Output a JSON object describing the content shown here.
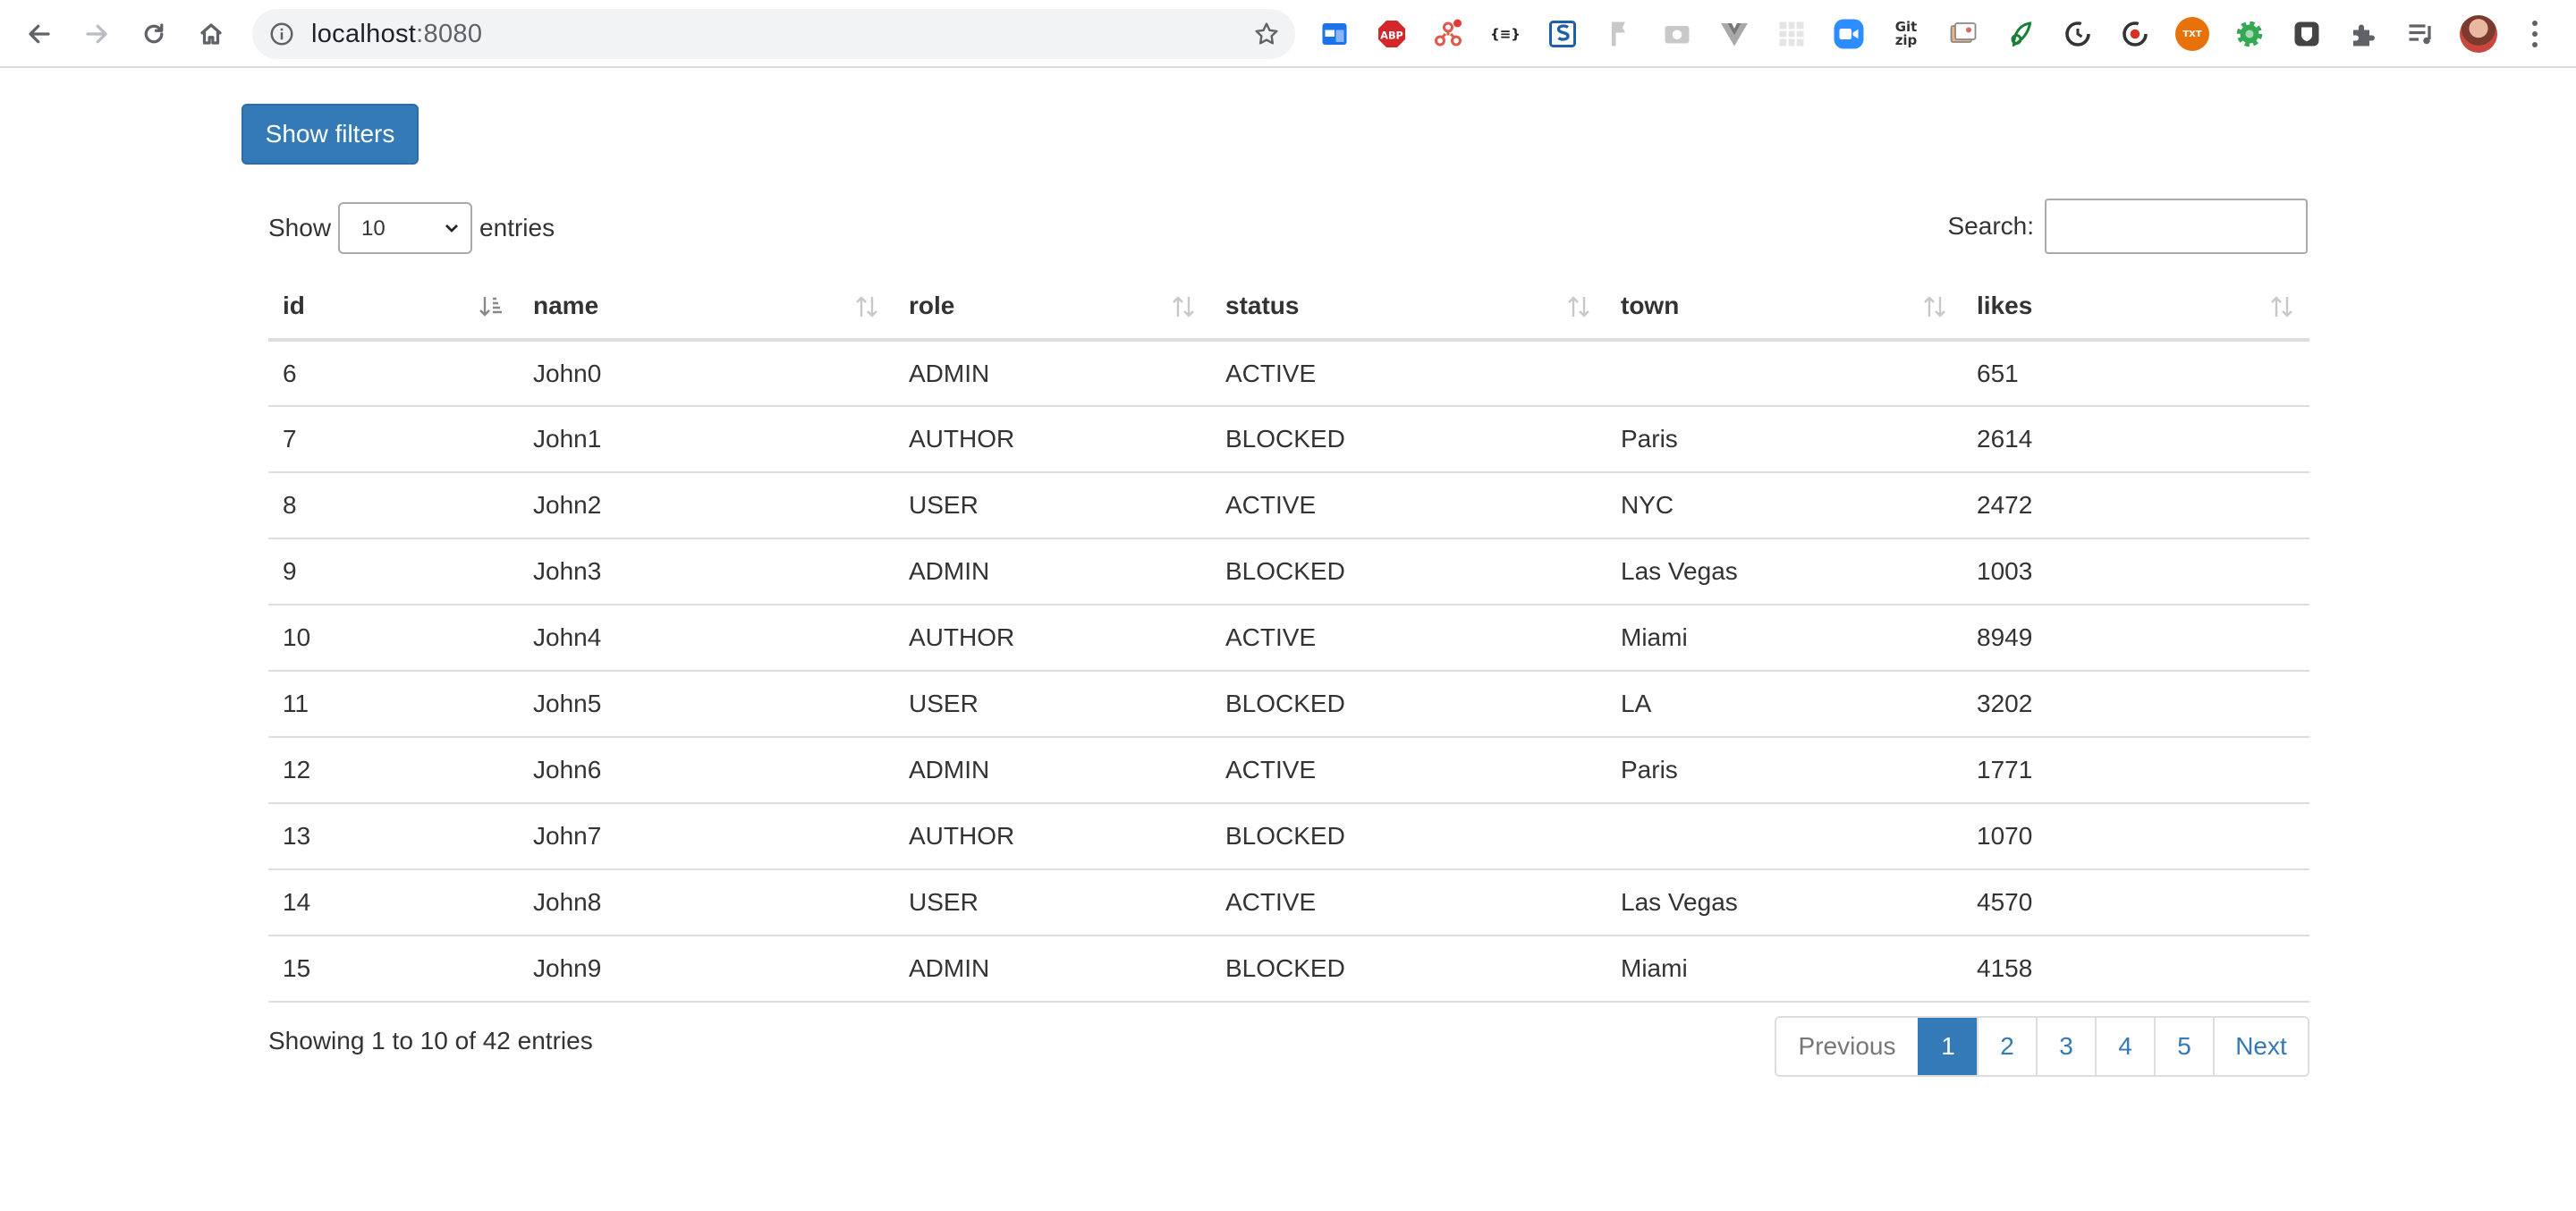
{
  "browser": {
    "url_host": "localhost",
    "url_port": ":8080",
    "extensions": [
      "calendar-extension-icon",
      "adblock-plus-icon",
      "network-extension-icon",
      "json-formatter-icon",
      "s-extension-icon",
      "bookmark-extension-icon",
      "camera-extension-icon",
      "vue-devtools-icon",
      "grid-extension-icon",
      "zoom-extension-icon",
      "gitzip-extension-icon",
      "screenshot-extension-icon",
      "leaf-extension-icon",
      "refresh-extension-icon",
      "record-extension-icon",
      "txt-extension-icon",
      "gear-extension-icon",
      "shield-extension-icon",
      "puzzle-extensions-icon",
      "reading-list-icon"
    ],
    "ext_labels": {
      "abp": "ABP",
      "json": "{≡}",
      "gitzip_top": "Git",
      "gitzip_bottom": "zip",
      "txt": "TXT"
    }
  },
  "page": {
    "filters_button": "Show filters",
    "length": {
      "before": "Show",
      "value": "10",
      "after": "entries"
    },
    "search": {
      "label": "Search:",
      "value": ""
    },
    "columns": [
      "id",
      "name",
      "role",
      "status",
      "town",
      "likes"
    ],
    "rows": [
      [
        "6",
        "John0",
        "ADMIN",
        "ACTIVE",
        "",
        "651"
      ],
      [
        "7",
        "John1",
        "AUTHOR",
        "BLOCKED",
        "Paris",
        "2614"
      ],
      [
        "8",
        "John2",
        "USER",
        "ACTIVE",
        "NYC",
        "2472"
      ],
      [
        "9",
        "John3",
        "ADMIN",
        "BLOCKED",
        "Las Vegas",
        "1003"
      ],
      [
        "10",
        "John4",
        "AUTHOR",
        "ACTIVE",
        "Miami",
        "8949"
      ],
      [
        "11",
        "John5",
        "USER",
        "BLOCKED",
        "LA",
        "3202"
      ],
      [
        "12",
        "John6",
        "ADMIN",
        "ACTIVE",
        "Paris",
        "1771"
      ],
      [
        "13",
        "John7",
        "AUTHOR",
        "BLOCKED",
        "",
        "1070"
      ],
      [
        "14",
        "John8",
        "USER",
        "ACTIVE",
        "Las Vegas",
        "4570"
      ],
      [
        "15",
        "John9",
        "ADMIN",
        "BLOCKED",
        "Miami",
        "4158"
      ]
    ],
    "info": "Showing 1 to 10 of 42 entries",
    "pagination": {
      "previous": "Previous",
      "pages": [
        "1",
        "2",
        "3",
        "4",
        "5"
      ],
      "active": "1",
      "next": "Next"
    }
  },
  "colors": {
    "primary": "#337ab7",
    "border": "#dddddd"
  }
}
